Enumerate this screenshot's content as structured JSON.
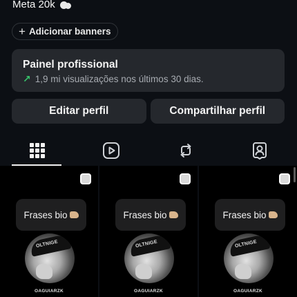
{
  "profile": {
    "bio_line": "Meta 20k",
    "banner_button": "Adicionar banners"
  },
  "panel": {
    "title": "Painel profissional",
    "stats": "1,9 mi visualizações nos últimos 30 dias."
  },
  "actions": {
    "edit": "Editar perfil",
    "share": "Compartilhar perfil"
  },
  "tabs": [
    {
      "icon": "grid-icon",
      "active": true
    },
    {
      "icon": "reels-icon",
      "active": false
    },
    {
      "icon": "repost-icon",
      "active": false
    },
    {
      "icon": "tagged-icon",
      "active": false
    }
  ],
  "posts": [
    {
      "caption": "Frases bio",
      "username": "OAGUIARZK",
      "cap_text": "OLTNIGE",
      "type": "reel"
    },
    {
      "caption": "Frases bio",
      "username": "OAGUIARZK",
      "cap_text": "OLTNIGE",
      "type": "reel"
    },
    {
      "caption": "Frases bio",
      "username": "OAGUIARZK",
      "cap_text": "OLTNIGE",
      "type": "reel"
    }
  ],
  "colors": {
    "background": "#0c0f14",
    "card": "#25282d",
    "trend_arrow": "#37c36b"
  }
}
